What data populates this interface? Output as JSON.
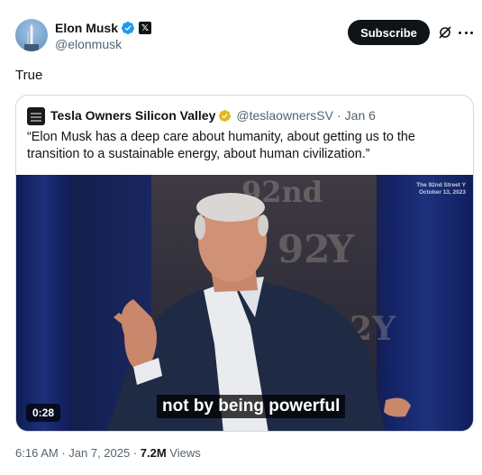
{
  "author": {
    "display_name": "Elon Musk",
    "handle": "@elonmusk",
    "verified": true,
    "affiliate_badge": "𝕏"
  },
  "actions": {
    "subscribe_label": "Subscribe",
    "grok_icon": "grok-icon",
    "more_icon": "more-icon"
  },
  "tweet": {
    "text": "True"
  },
  "quote": {
    "display_name": "Tesla Owners Silicon Valley",
    "handle": "@teslaownersSV",
    "separator": "·",
    "date": "Jan 6",
    "verified": "gold",
    "text": "“Elon Musk has a deep care about humanity, about getting us to the transition to a sustainable energy, about human civilization.”",
    "video": {
      "duration": "0:28",
      "subtitle": "not by being powerful",
      "corner_line1": "The 92nd Street Y",
      "corner_line2": "October 13, 2023",
      "watermark_1": "92",
      "watermark_2": "Y",
      "watermark_3": "92Y",
      "watermark_4": "92nd"
    }
  },
  "meta": {
    "time": "6:16 AM",
    "sep1": " · ",
    "date": "Jan 7, 2025",
    "sep2": " · ",
    "views_count": "7.2M",
    "views_label": " Views"
  },
  "colors": {
    "verified_blue": "#1d9bf0",
    "verified_gold": "#e2b719",
    "text_primary": "#0f1419",
    "text_secondary": "#536471",
    "border": "#cfd9de"
  }
}
